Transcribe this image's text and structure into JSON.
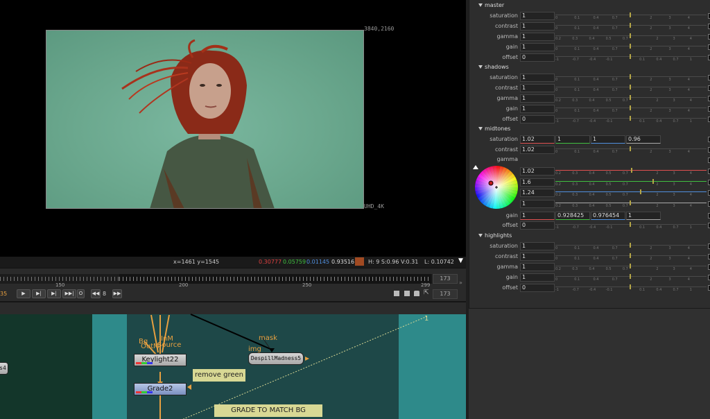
{
  "viewer": {
    "format_top": "3840,2160",
    "format_bottom": "UHD_4K"
  },
  "infobar": {
    "coords": "x=1461 y=1545",
    "r": "0.30777",
    "g": "0.05759",
    "b": "0.01145",
    "a": "0.93516",
    "swatch_color": "#a14a22",
    "hsv": "H:  9 S:0.96 V:0.31",
    "lum": "L: 0.10742"
  },
  "timeline": {
    "ticks": [
      "150",
      "200",
      "250",
      "299"
    ],
    "current_frame": "35",
    "end_frame_top": "173",
    "end_frame_bottom": "173",
    "step": "8",
    "play_label": "▶",
    "next_key_label": "▶|",
    "prev_label": "▶|",
    "end_label": "▶▶|",
    "loop_label": "O",
    "back_step_label": "◀◀",
    "fwd_step_label": "▶▶"
  },
  "nodegraph": {
    "nodes": {
      "keylight": "Keylight22",
      "grade": "Grade2",
      "despill": "DespillMadness5",
      "left_edge": "s4"
    },
    "labels": {
      "bg": "Bg",
      "outm": "OutM",
      "inm": "InM",
      "source": "Source",
      "mask": "mask",
      "img": "img",
      "one": "1"
    },
    "stickies": {
      "remove_green": "remove green",
      "grade_to_match": "GRADE TO MATCH BG"
    }
  },
  "props": {
    "sections": {
      "master": "master",
      "shadows": "shadows",
      "midtones": "midtones",
      "highlights": "highlights"
    },
    "labels": {
      "saturation": "saturation",
      "contrast": "contrast",
      "gamma": "gamma",
      "gain": "gain",
      "offset": "offset"
    },
    "master": {
      "saturation": "1",
      "contrast": "1",
      "gamma": "1",
      "gain": "1",
      "offset": "0"
    },
    "shadows": {
      "saturation": "1",
      "contrast": "1",
      "gamma": "1",
      "gain": "1",
      "offset": "0"
    },
    "midtones": {
      "saturation_r": "1.02",
      "saturation_g": "1",
      "saturation_b": "1",
      "saturation_a": "0.96",
      "contrast": "1.02",
      "gamma_r": "1.02",
      "gamma_g": "1.6",
      "gamma_b": "1.24",
      "gamma_a": "1",
      "gain_r": "1",
      "gain_g": "0.928425",
      "gain_b": "0.976454",
      "gain_a": "1",
      "offset": "0"
    },
    "highlights": {
      "saturation": "1",
      "contrast": "1",
      "gamma": "1",
      "gain": "1",
      "offset": "0"
    },
    "scales": {
      "mult": [
        "0",
        "0.1",
        "0.4",
        "0.7",
        "",
        "2",
        "3",
        "4"
      ],
      "gamma": [
        "0.2",
        "0.3",
        "0.4",
        "0.5",
        "0.7",
        "",
        "2",
        "3",
        "4"
      ],
      "offset": [
        "-1",
        "-0.7",
        "-0.4",
        "-0.1",
        "",
        "0.1",
        "0.4",
        "0.7",
        "1"
      ]
    }
  }
}
